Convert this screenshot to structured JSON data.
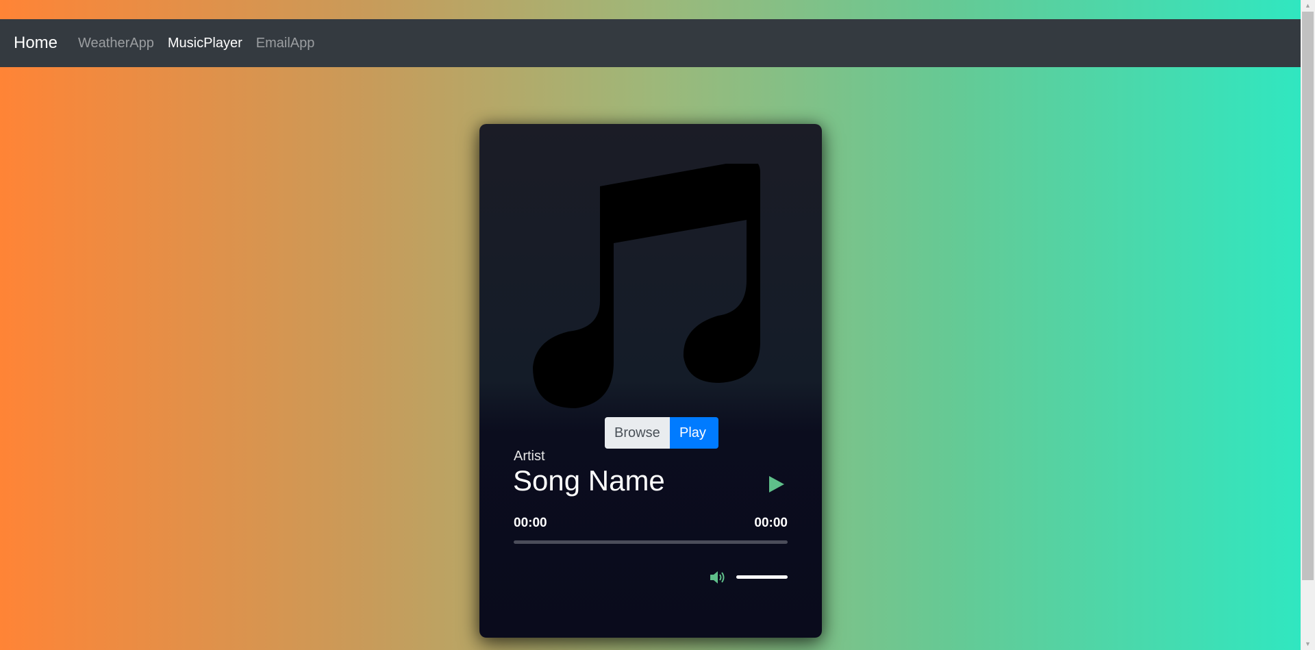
{
  "navbar": {
    "brand": "Home",
    "links": [
      {
        "label": "WeatherApp",
        "active": false
      },
      {
        "label": "MusicPlayer",
        "active": true
      },
      {
        "label": "EmailApp",
        "active": false
      }
    ]
  },
  "player": {
    "artwork_icon": "music-note-icon",
    "buttons": {
      "browse": "Browse",
      "play": "Play"
    },
    "artist": "Artist",
    "song_name": "Song Name",
    "play_icon": "play-icon",
    "time_current": "00:00",
    "time_total": "00:00",
    "progress": 0,
    "volume_icon": "volume-icon",
    "volume": 1.0
  },
  "colors": {
    "navbar_bg": "#343a40",
    "accent_play": "#007bff",
    "icon_green": "#5fbf8a",
    "gradient_left": "#ff8436",
    "gradient_right": "#2ee8c2"
  }
}
